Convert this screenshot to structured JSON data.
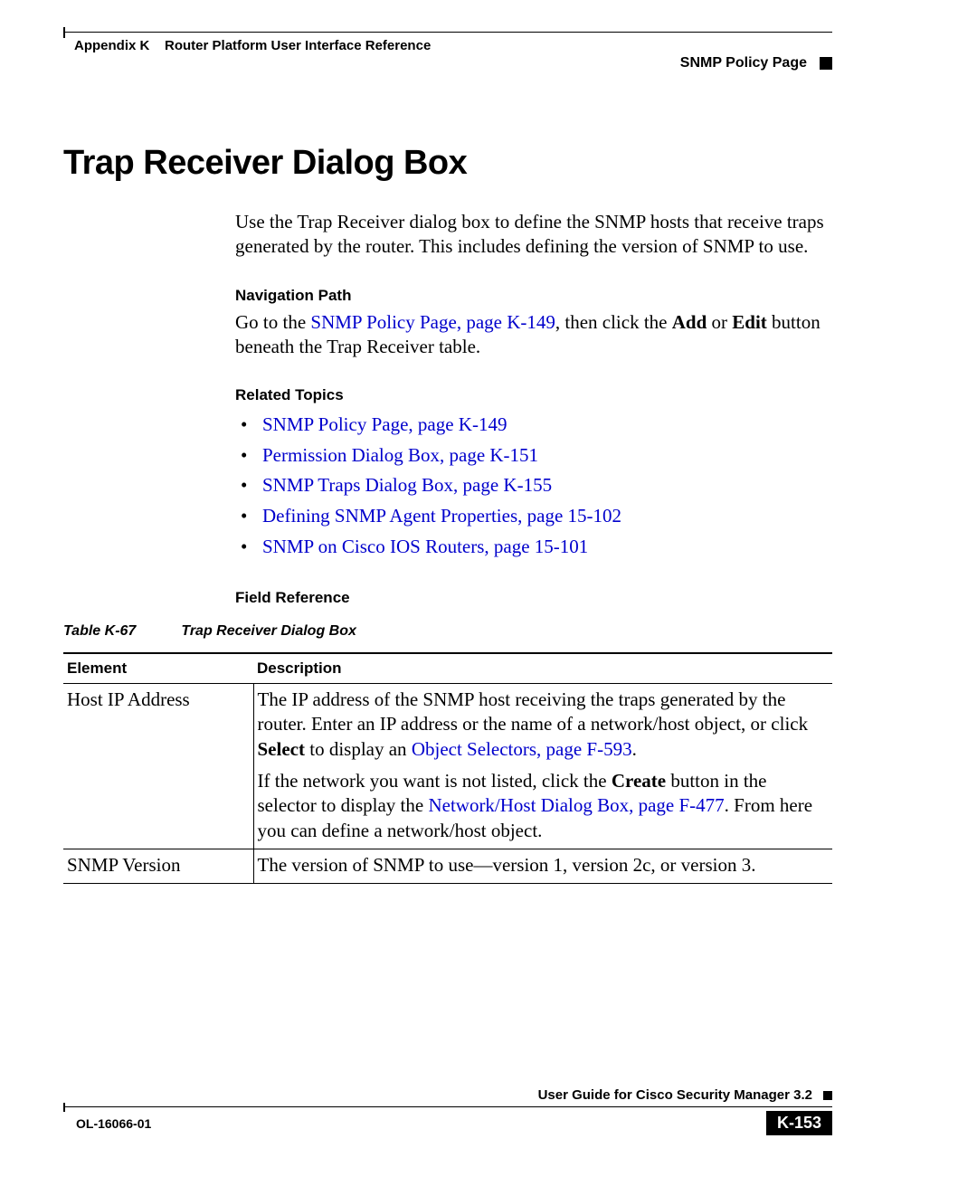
{
  "header": {
    "appendix": "Appendix K",
    "chapter": "Router Platform User Interface Reference",
    "section": "SNMP Policy Page"
  },
  "title": "Trap Receiver Dialog Box",
  "intro": "Use the Trap Receiver dialog box to define the SNMP hosts that receive traps generated by the router. This includes defining the version of SNMP to use.",
  "navpath": {
    "heading": "Navigation Path",
    "prefix": "Go to the ",
    "link": "SNMP Policy Page, page K-149",
    "mid": ", then click the ",
    "add": "Add",
    "or": " or ",
    "edit": "Edit",
    "suffix": " button beneath the Trap Receiver table."
  },
  "related": {
    "heading": "Related Topics",
    "items": [
      "SNMP Policy Page, page K-149",
      "Permission Dialog Box, page K-151",
      "SNMP Traps Dialog Box, page K-155",
      "Defining SNMP Agent Properties, page 15-102",
      "SNMP on Cisco IOS Routers, page 15-101"
    ]
  },
  "fieldref": {
    "heading": "Field Reference",
    "table_label": "Table K-67",
    "table_title": "Trap Receiver Dialog Box",
    "col_element": "Element",
    "col_description": "Description",
    "rows": [
      {
        "element": "Host IP Address",
        "p1a": "The IP address of the SNMP host receiving the traps generated by the router. Enter an IP address or the name of a network/host object, or click ",
        "p1b": "Select",
        "p1c": " to display an ",
        "p1link": "Object Selectors, page F-593",
        "p1d": ".",
        "p2a": "If the network you want is not listed, click the ",
        "p2b": "Create",
        "p2c": " button in the selector to display the ",
        "p2link": "Network/Host Dialog Box, page F-477",
        "p2d": ". From here you can define a network/host object."
      },
      {
        "element": "SNMP Version",
        "desc": "The version of SNMP to use—version 1, version 2c, or version 3."
      }
    ]
  },
  "footer": {
    "guide": "User Guide for Cisco Security Manager 3.2",
    "docnum": "OL-16066-01",
    "pagenum": "K-153"
  }
}
